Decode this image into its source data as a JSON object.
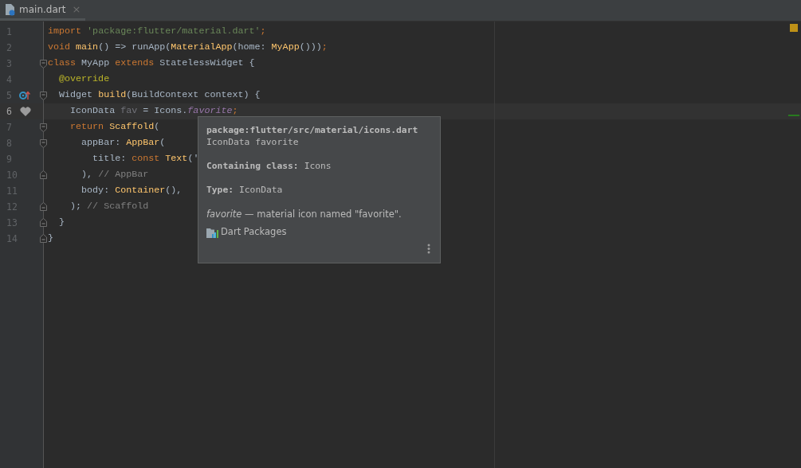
{
  "tabs": [
    {
      "label": "main.dart",
      "close": "×",
      "selected": true
    }
  ],
  "editor": {
    "lines": [
      {
        "number": "1",
        "current": false,
        "tokens": [
          {
            "t": "import ",
            "kind": "keyword"
          },
          {
            "t": "'package:flutter/material.dart'",
            "kind": "string"
          },
          {
            "t": ";",
            "kind": "keyword"
          }
        ]
      },
      {
        "number": "2",
        "current": false,
        "tokens": [
          {
            "t": "void ",
            "kind": "keyword"
          },
          {
            "t": "main",
            "kind": "function"
          },
          {
            "t": "() => runApp(",
            "kind": "plain"
          },
          {
            "t": "MaterialApp",
            "kind": "function"
          },
          {
            "t": "(home: ",
            "kind": "plain"
          },
          {
            "t": "MyApp",
            "kind": "function"
          },
          {
            "t": "()))",
            "kind": "plain"
          },
          {
            "t": ";",
            "kind": "keyword"
          }
        ]
      },
      {
        "number": "3",
        "current": false,
        "fold": {
          "kind": "start"
        },
        "tokens": [
          {
            "t": "class ",
            "kind": "keyword"
          },
          {
            "t": "MyApp ",
            "kind": "plain"
          },
          {
            "t": "extends ",
            "kind": "keyword"
          },
          {
            "t": "StatelessWidget {",
            "kind": "plain"
          }
        ]
      },
      {
        "number": "4",
        "current": false,
        "tokens": [
          {
            "t": "  @override",
            "kind": "annotation"
          }
        ]
      },
      {
        "number": "5",
        "current": false,
        "fold": {
          "kind": "start"
        },
        "marker": {
          "kind": "override"
        },
        "tokens": [
          {
            "t": "  Widget ",
            "kind": "plain"
          },
          {
            "t": "build",
            "kind": "function"
          },
          {
            "t": "(BuildContext context) {",
            "kind": "plain"
          }
        ]
      },
      {
        "number": "6",
        "current": true,
        "marker": {
          "kind": "heart"
        },
        "tokens": [
          {
            "t": "    IconData ",
            "kind": "plain"
          },
          {
            "t": "fav",
            "kind": "unused"
          },
          {
            "t": " = Icons.",
            "kind": "plain"
          },
          {
            "t": "favorite",
            "kind": "field"
          },
          {
            "t": ";",
            "kind": "keyword"
          }
        ]
      },
      {
        "number": "7",
        "current": false,
        "fold": {
          "kind": "start"
        },
        "tokens": [
          {
            "t": "    return ",
            "kind": "keyword"
          },
          {
            "t": "Scaffold",
            "kind": "function"
          },
          {
            "t": "(",
            "kind": "plain"
          }
        ]
      },
      {
        "number": "8",
        "current": false,
        "fold": {
          "kind": "start"
        },
        "tokens": [
          {
            "t": "      appBar: ",
            "kind": "plain"
          },
          {
            "t": "AppBar",
            "kind": "function"
          },
          {
            "t": "(",
            "kind": "plain"
          }
        ]
      },
      {
        "number": "9",
        "current": false,
        "tokens": [
          {
            "t": "        title: ",
            "kind": "plain"
          },
          {
            "t": "const ",
            "kind": "keyword"
          },
          {
            "t": "Text",
            "kind": "function"
          },
          {
            "t": "('",
            "kind": "plain"
          }
        ]
      },
      {
        "number": "10",
        "current": false,
        "fold": {
          "kind": "end"
        },
        "tokens": [
          {
            "t": "      ), ",
            "kind": "plain"
          },
          {
            "t": "// AppBar",
            "kind": "comment"
          }
        ]
      },
      {
        "number": "11",
        "current": false,
        "tokens": [
          {
            "t": "      body: ",
            "kind": "plain"
          },
          {
            "t": "Container",
            "kind": "function"
          },
          {
            "t": "(),",
            "kind": "plain"
          }
        ]
      },
      {
        "number": "12",
        "current": false,
        "fold": {
          "kind": "end"
        },
        "tokens": [
          {
            "t": "    ); ",
            "kind": "plain"
          },
          {
            "t": "// Scaffold",
            "kind": "comment"
          }
        ]
      },
      {
        "number": "13",
        "current": false,
        "fold": {
          "kind": "end"
        },
        "tokens": [
          {
            "t": "  }",
            "kind": "plain"
          }
        ]
      },
      {
        "number": "14",
        "current": false,
        "fold": {
          "kind": "end"
        },
        "tokens": [
          {
            "t": "}",
            "kind": "plain"
          }
        ]
      }
    ]
  },
  "doc_popup": {
    "path": "package:flutter/src/material/icons.dart",
    "signature": "IconData favorite",
    "containing_label": "Containing class:",
    "containing_value": "Icons",
    "type_label": "Type:",
    "type_value": "IconData",
    "description": "*favorite* — material icon named \"favorite\".",
    "link": "Dart Packages"
  }
}
